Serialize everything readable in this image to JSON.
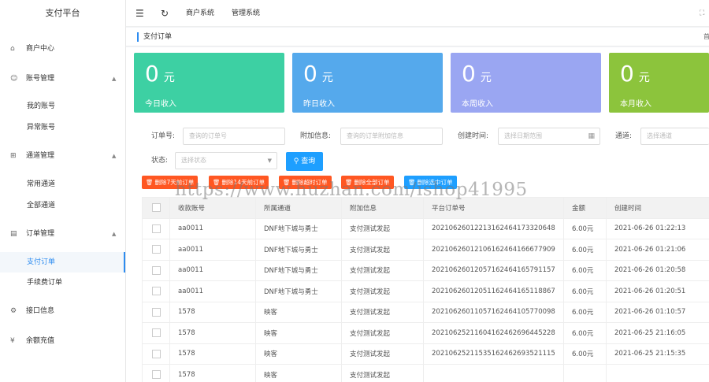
{
  "app": {
    "brand": "支付平台"
  },
  "sidebar": {
    "items": [
      {
        "label": "商户中心",
        "icon": "home-icon"
      },
      {
        "label": "账号管理",
        "icon": "user-icon"
      },
      {
        "label": "我的账号"
      },
      {
        "label": "异常账号"
      },
      {
        "label": "通道管理",
        "icon": "channel-icon"
      },
      {
        "label": "常用通道"
      },
      {
        "label": "全部通道"
      },
      {
        "label": "订单管理",
        "icon": "order-icon"
      },
      {
        "label": "支付订单"
      },
      {
        "label": "手续费订单"
      },
      {
        "label": "接口信息",
        "icon": "gear-icon"
      },
      {
        "label": "余额充值",
        "icon": "yen-icon"
      }
    ]
  },
  "topbar": {
    "menu1": "商户系统",
    "menu2": "管理系统"
  },
  "breadcrumb": {
    "current": "支付订单",
    "right": "首"
  },
  "cards": [
    {
      "value": "0",
      "unit": "元",
      "caption": "今日收入",
      "color": "#3dd0a3"
    },
    {
      "value": "0",
      "unit": "元",
      "caption": "昨日收入",
      "color": "#55a9ec"
    },
    {
      "value": "0",
      "unit": "元",
      "caption": "本周收入",
      "color": "#9aa6f2"
    },
    {
      "value": "0",
      "unit": "元",
      "caption": "本月收入",
      "color": "#8cc43c"
    }
  ],
  "filters": {
    "order_label": "订单号:",
    "order_placeholder": "查询的订单号",
    "extra_label": "附加信息:",
    "extra_placeholder": "查询的订单附加信息",
    "created_label": "创建时间:",
    "created_placeholder": "选择日期范围",
    "channel_label": "通道:",
    "channel_placeholder": "选择通道",
    "status_label": "状态:",
    "status_placeholder": "选择状态",
    "query_label": "查询"
  },
  "actions": [
    {
      "label": "删除7天前订单",
      "color": "#ff5722"
    },
    {
      "label": "删除14天前订单",
      "color": "#ff5722"
    },
    {
      "label": "删除超时订单",
      "color": "#ff5722"
    },
    {
      "label": "删除全部订单",
      "color": "#ff5722"
    },
    {
      "label": "删除选中订单",
      "color": "#1e9fff"
    }
  ],
  "watermark": "https://www.huzhan.com/ishop41995",
  "table": {
    "headers": [
      "收款账号",
      "所属通道",
      "附加信息",
      "平台订单号",
      "金额",
      "创建时间"
    ],
    "rows": [
      [
        "aa0011",
        "DNF地下城与勇士",
        "支付测试发起",
        "20210626012213162464173320648",
        "6.00元",
        "2021-06-26 01:22:13"
      ],
      [
        "aa0011",
        "DNF地下城与勇士",
        "支付测试发起",
        "20210626012106162464166677909",
        "6.00元",
        "2021-06-26 01:21:06"
      ],
      [
        "aa0011",
        "DNF地下城与勇士",
        "支付测试发起",
        "20210626012057162464165791157",
        "6.00元",
        "2021-06-26 01:20:58"
      ],
      [
        "aa0011",
        "DNF地下城与勇士",
        "支付测试发起",
        "20210626012051162464165118867",
        "6.00元",
        "2021-06-26 01:20:51"
      ],
      [
        "1578",
        "映客",
        "支付测试发起",
        "20210626011057162464105770098",
        "6.00元",
        "2021-06-26 01:10:57"
      ],
      [
        "1578",
        "映客",
        "支付测试发起",
        "20210625211604162462696445228",
        "6.00元",
        "2021-06-25 21:16:05"
      ],
      [
        "1578",
        "映客",
        "支付测试发起",
        "20210625211535162462693521115",
        "6.00元",
        "2021-06-25 21:15:35"
      ],
      [
        "1578",
        "映客",
        "支付测试发起",
        "",
        "",
        ""
      ]
    ]
  }
}
